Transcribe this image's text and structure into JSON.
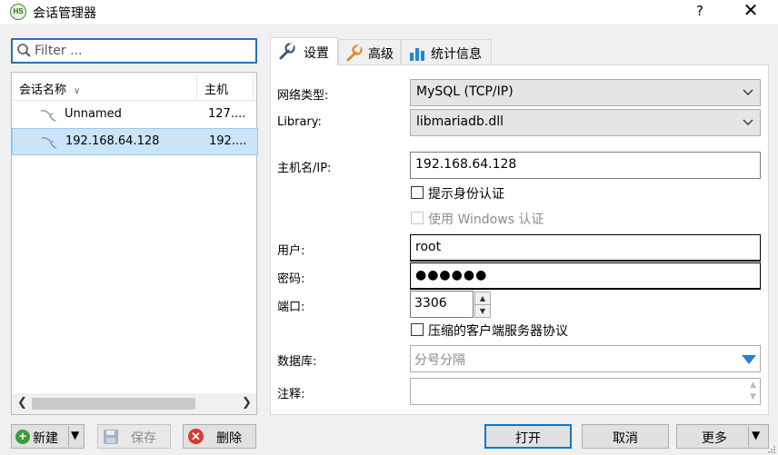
{
  "window": {
    "icon_text": "HS",
    "title": "会话管理器",
    "help": "?",
    "close": "✕"
  },
  "filter": {
    "placeholder": "Filter ..."
  },
  "session_list": {
    "columns": [
      "会话名称",
      "主机"
    ],
    "rows": [
      {
        "name": "Unnamed",
        "host": "127....",
        "selected": false
      },
      {
        "name": "192.168.64.128",
        "host": "192....",
        "selected": true
      }
    ]
  },
  "left_buttons": {
    "new": "新建",
    "save": "保存",
    "delete": "删除"
  },
  "tabs": [
    {
      "label": "设置",
      "icon": "wrench-icon",
      "active": true
    },
    {
      "label": "高级",
      "icon": "wrench-orange-icon",
      "active": false
    },
    {
      "label": "统计信息",
      "icon": "bar-chart-icon",
      "active": false
    }
  ],
  "settings": {
    "network_type": {
      "label": "网络类型:",
      "value": "MySQL (TCP/IP)"
    },
    "library": {
      "label": "Library:",
      "value": "libmariadb.dll"
    },
    "host": {
      "label": "主机名/IP:",
      "value": "192.168.64.128"
    },
    "prompt_credentials": {
      "label": "提示身份认证",
      "checked": false
    },
    "windows_auth": {
      "label": "使用 Windows 认证",
      "checked": false,
      "disabled": true
    },
    "user": {
      "label": "用户:",
      "value": "root"
    },
    "password": {
      "label": "密码:",
      "value": "●●●●●●"
    },
    "port": {
      "label": "端口:",
      "value": "3306"
    },
    "compressed": {
      "label": "压缩的客户端服务器协议",
      "checked": false
    },
    "databases": {
      "label": "数据库:",
      "placeholder": "分号分隔"
    },
    "comment": {
      "label": "注释:",
      "value": ""
    }
  },
  "right_buttons": {
    "open": "打开",
    "cancel": "取消",
    "more": "更多"
  },
  "colors": {
    "accent": "#0078d7",
    "selection": "#cce4f7",
    "new_icon": "#3a9d3a",
    "delete_icon": "#d63b2f",
    "dropdown_arrow": "#2a7fd4"
  }
}
